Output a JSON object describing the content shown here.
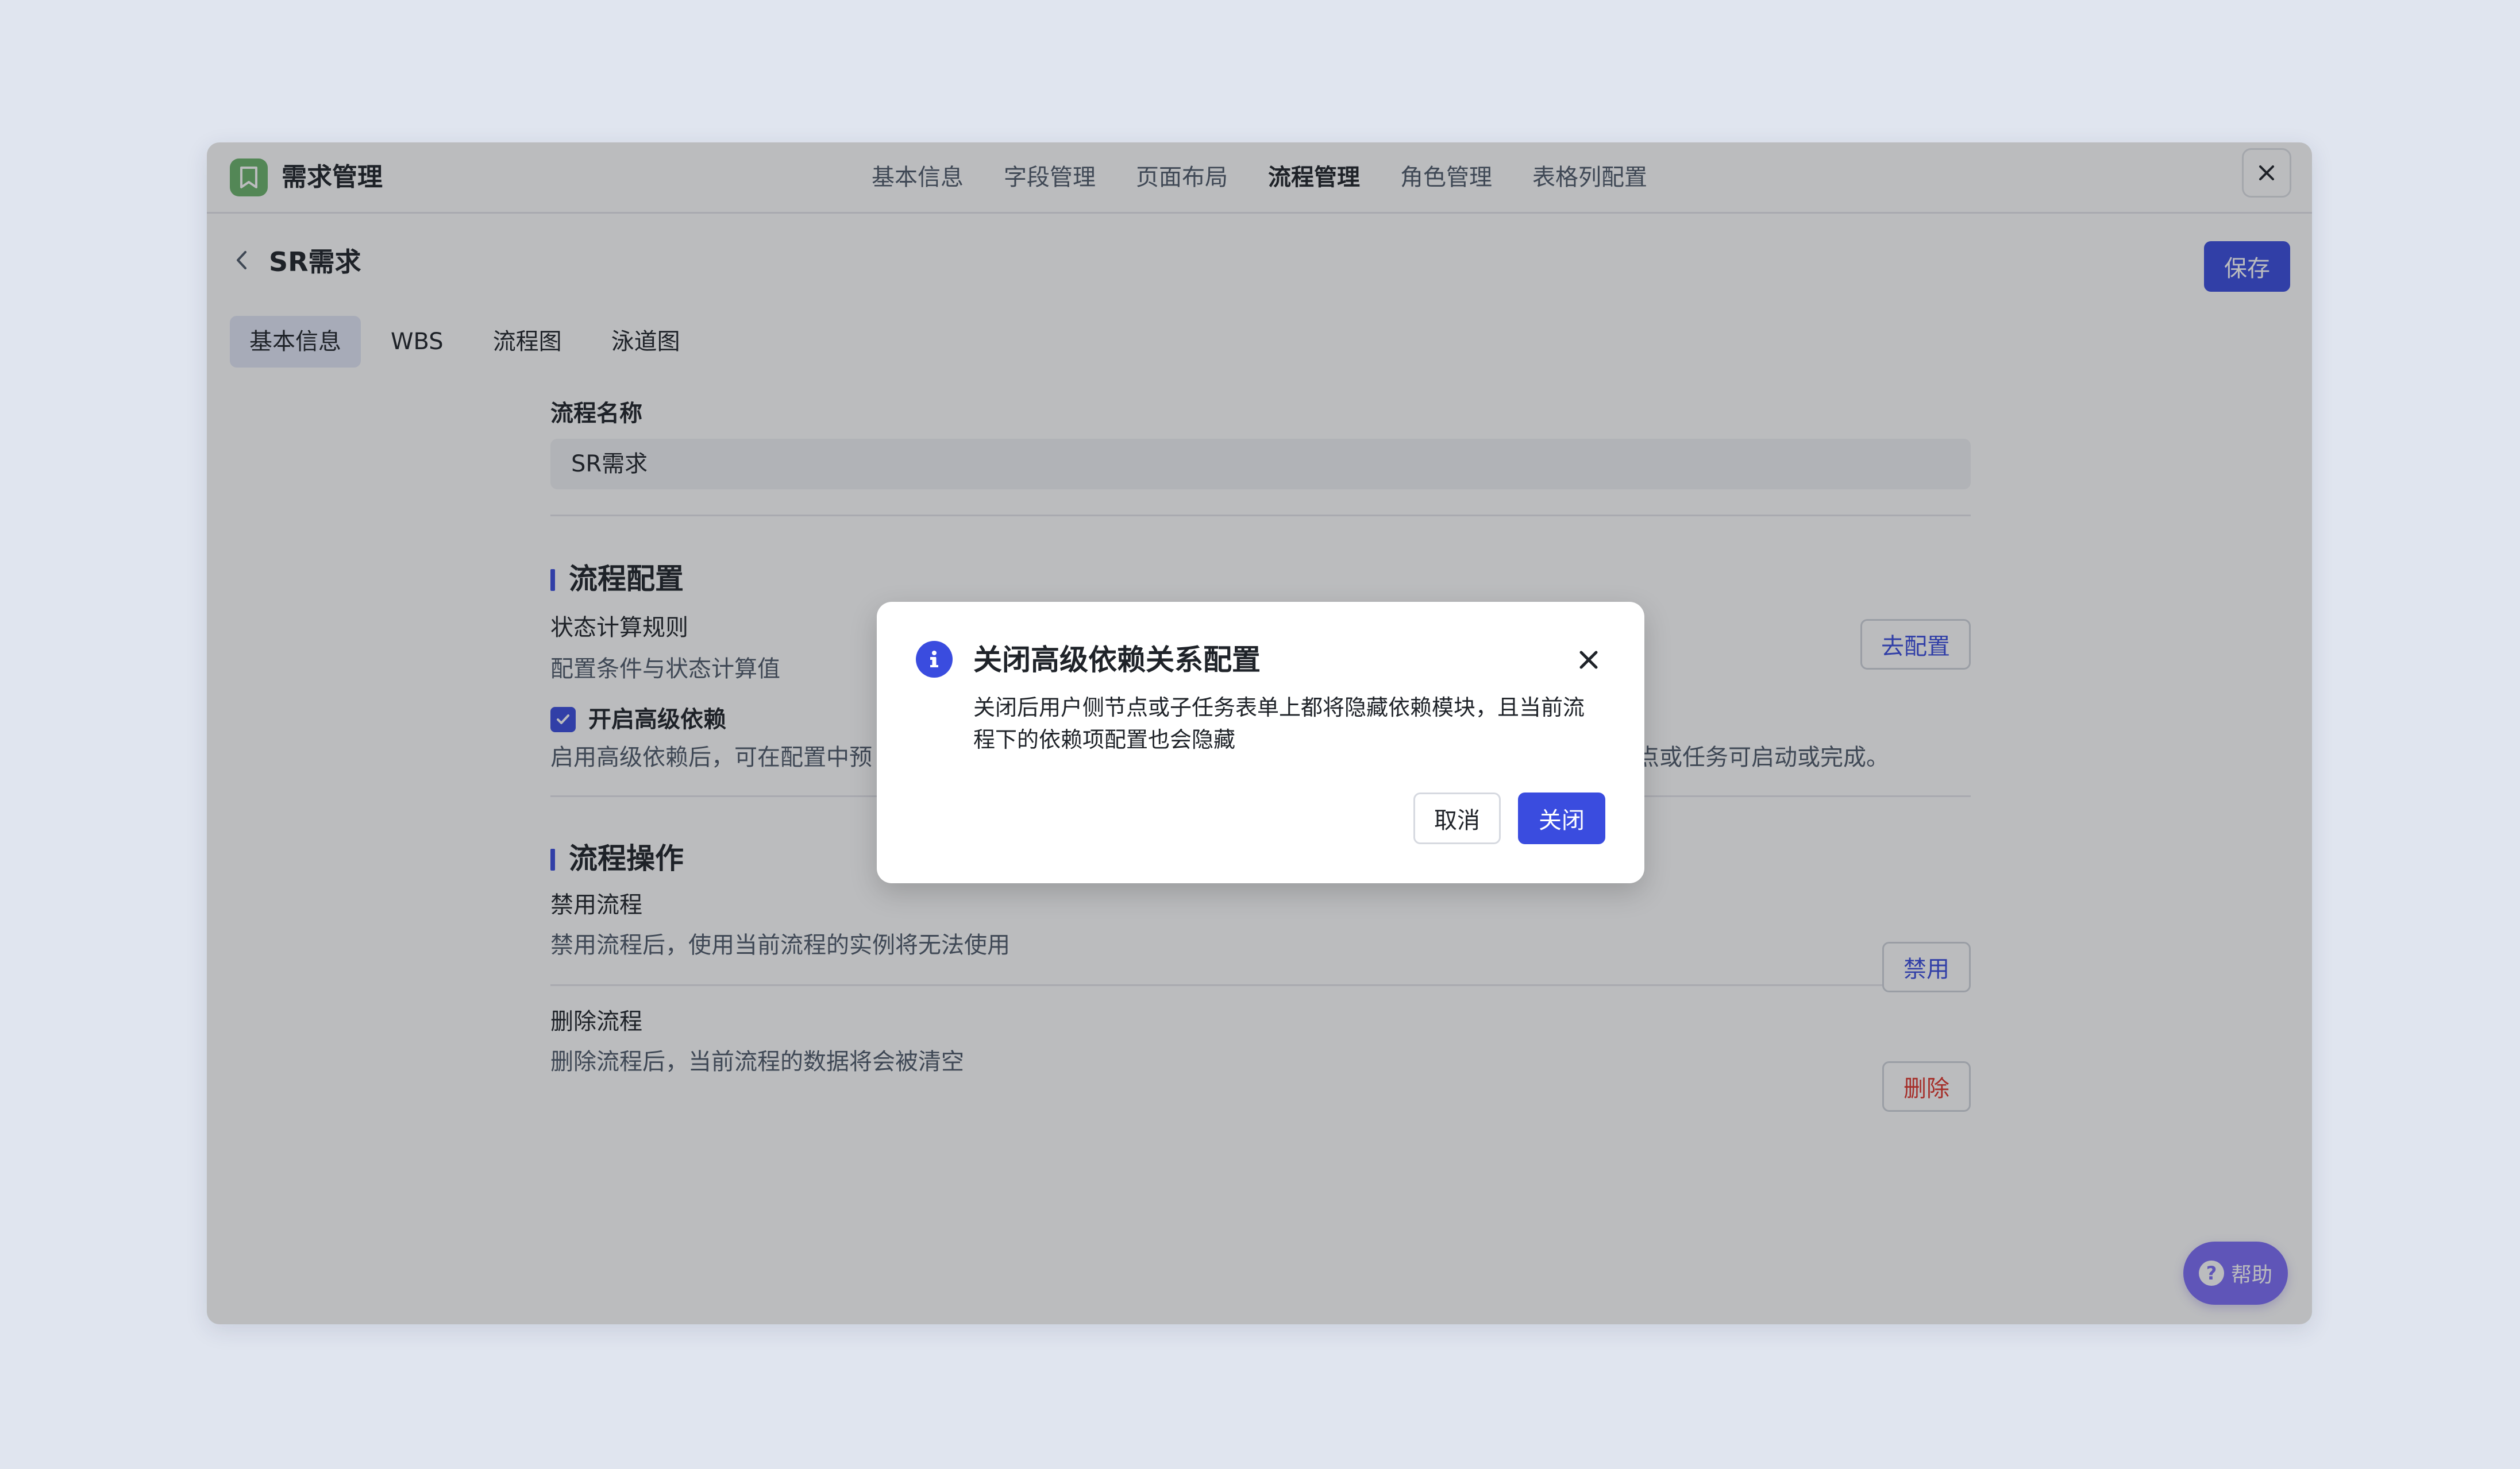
{
  "app": {
    "title": "需求管理",
    "icon": "bookmark-icon"
  },
  "top_nav": [
    {
      "label": "基本信息",
      "active": false
    },
    {
      "label": "字段管理",
      "active": false
    },
    {
      "label": "页面布局",
      "active": false
    },
    {
      "label": "流程管理",
      "active": true
    },
    {
      "label": "角色管理",
      "active": false
    },
    {
      "label": "表格列配置",
      "active": false
    }
  ],
  "header": {
    "title": "SR需求",
    "save_label": "保存"
  },
  "sub_tabs": [
    {
      "label": "基本信息",
      "active": true
    },
    {
      "label": "WBS",
      "active": false
    },
    {
      "label": "流程图",
      "active": false
    },
    {
      "label": "泳道图",
      "active": false
    }
  ],
  "form": {
    "name_label": "流程名称",
    "name_value": "SR需求"
  },
  "config": {
    "section_title": "流程配置",
    "status_rule_title": "状态计算规则",
    "status_rule_desc": "配置条件与状态计算值",
    "configure_label": "去配置",
    "advanced_dep_label": "开启高级依赖",
    "advanced_dep_checked": true,
    "advanced_dep_desc_left": "启用高级依赖后，可在配置中预",
    "advanced_dep_desc_right": "，节点或任务可启动或完成。"
  },
  "operations": {
    "section_title": "流程操作",
    "disable_title": "禁用流程",
    "disable_desc": "禁用流程后，使用当前流程的实例将无法使用",
    "disable_label": "禁用",
    "delete_title": "删除流程",
    "delete_desc": "删除流程后，当前流程的数据将会被清空",
    "delete_label": "删除"
  },
  "help": {
    "label": "帮助"
  },
  "modal": {
    "title": "关闭高级依赖关系配置",
    "body": "关闭后用户侧节点或子任务表单上都将隐藏依赖模块，且当前流程下的依赖项配置也会隐藏",
    "cancel_label": "取消",
    "confirm_label": "关闭"
  },
  "colors": {
    "primary": "#3a4cdf",
    "danger": "#e0352b",
    "app_icon": "#6bb36a",
    "help": "#7b6cf6"
  }
}
